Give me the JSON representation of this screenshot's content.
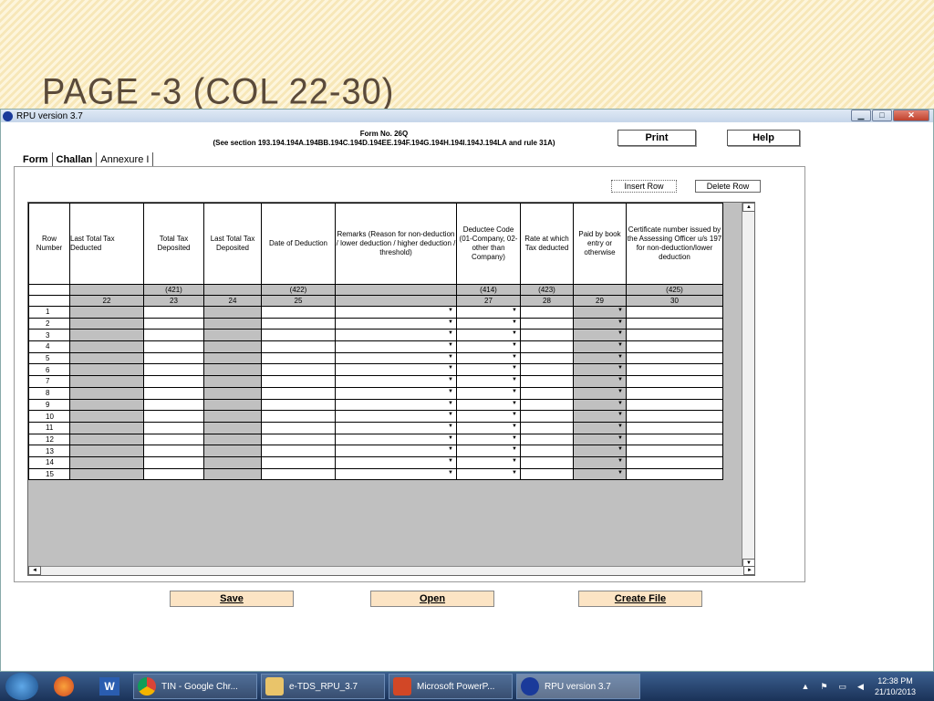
{
  "slide": {
    "title": "PAGE -3 (COL 22-30)"
  },
  "window": {
    "title": "RPU version 3.7"
  },
  "form": {
    "line1": "Form No. 26Q",
    "line2": "(See section 193.194.194A.194BB.194C.194D.194EE.194F.194G.194H.194I.194J.194LA and rule 31A)"
  },
  "buttons": {
    "print": "Print",
    "help": "Help",
    "insert_row": "Insert Row",
    "delete_row": "Delete Row",
    "save": "Save",
    "open": "Open",
    "create_file": "Create File"
  },
  "tabs": [
    "Form",
    "Challan",
    "Annexure I"
  ],
  "table": {
    "headers": [
      "Row Number",
      "Last Total Tax Deducted",
      "Total Tax Deposited",
      "Last Total Tax Deposited",
      "Date of Deduction",
      "Remarks (Reason for non-deduction / lower deduction / higher deduction / threshold)",
      "Deductee Code (01-Company, 02-other than Company)",
      "Rate at which Tax deducted",
      "Paid by book entry or otherwise",
      "Certificate number issued by the Assessing Officer u/s 197 for non-deduction/lower deduction"
    ],
    "codes": [
      "",
      "",
      "(421)",
      "",
      "(422)",
      "",
      "(414)",
      "(423)",
      "",
      "(425)"
    ],
    "colnums": [
      "",
      "22",
      "23",
      "24",
      "25",
      "",
      "27",
      "28",
      "29",
      "30"
    ],
    "rows": [
      "1",
      "2",
      "3",
      "4",
      "5",
      "6",
      "7",
      "8",
      "9",
      "10",
      "11",
      "12",
      "13",
      "14",
      "15"
    ]
  },
  "taskbar": {
    "items": [
      "TIN - Google Chr...",
      "e-TDS_RPU_3.7",
      "Microsoft PowerP...",
      "RPU version 3.7"
    ],
    "time": "12:38 PM",
    "date": "21/10/2013"
  }
}
